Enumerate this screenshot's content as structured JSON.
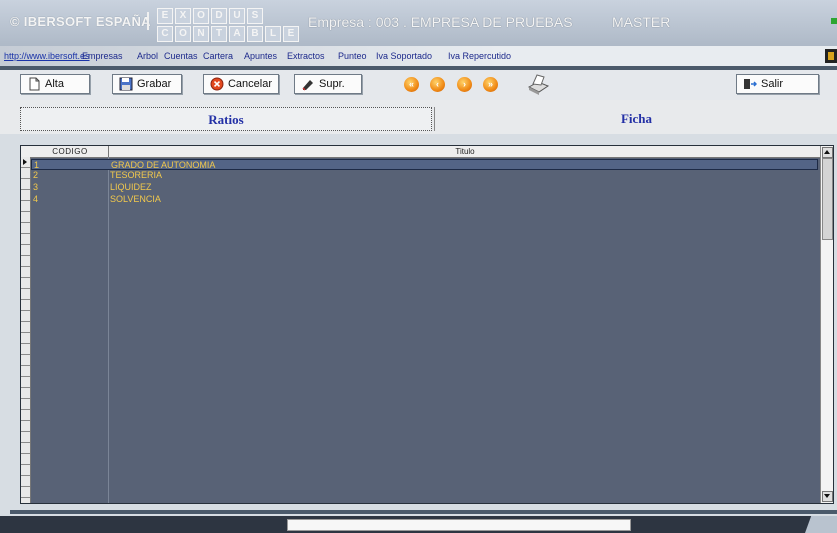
{
  "header": {
    "brand": "© IBERSOFT ESPAÑA",
    "exodus_top": [
      "E",
      "X",
      "O",
      "D",
      "U",
      "S"
    ],
    "exodus_bottom": [
      "C",
      "O",
      "N",
      "T",
      "A",
      "B",
      "L",
      "E"
    ],
    "company": "Empresa : 003 . EMPRESA DE PRUEBAS",
    "user": "MASTER"
  },
  "menu": {
    "url": "http://www.ibersoft.es",
    "items": [
      "Empresas",
      "Arbol",
      "Cuentas",
      "Cartera",
      "Apuntes",
      "Extractos",
      "Punteo",
      "Iva Soportado",
      "Iva Repercutido"
    ]
  },
  "toolbar": {
    "alta": "Alta",
    "grabar": "Grabar",
    "cancelar": "Cancelar",
    "supr": "Supr.",
    "salir": "Salir",
    "nav_icons": [
      "first-icon",
      "prev-icon",
      "next-icon",
      "last-icon",
      "print-icon"
    ]
  },
  "tabs": {
    "ratios": "Ratios",
    "ficha": "Ficha"
  },
  "grid": {
    "col_codigo": "CODIGO",
    "col_titulo": "Titulo",
    "rows": [
      {
        "code": "1",
        "title": "GRADO DE AUTONOMIA"
      },
      {
        "code": "2",
        "title": "TESORERIA"
      },
      {
        "code": "3",
        "title": "LIQUIDEZ"
      },
      {
        "code": "4",
        "title": "SOLVENCIA"
      }
    ]
  },
  "colors": {
    "grid_bg": "#586276",
    "row_text": "#f2c94c",
    "tab_text": "#2330a6"
  }
}
